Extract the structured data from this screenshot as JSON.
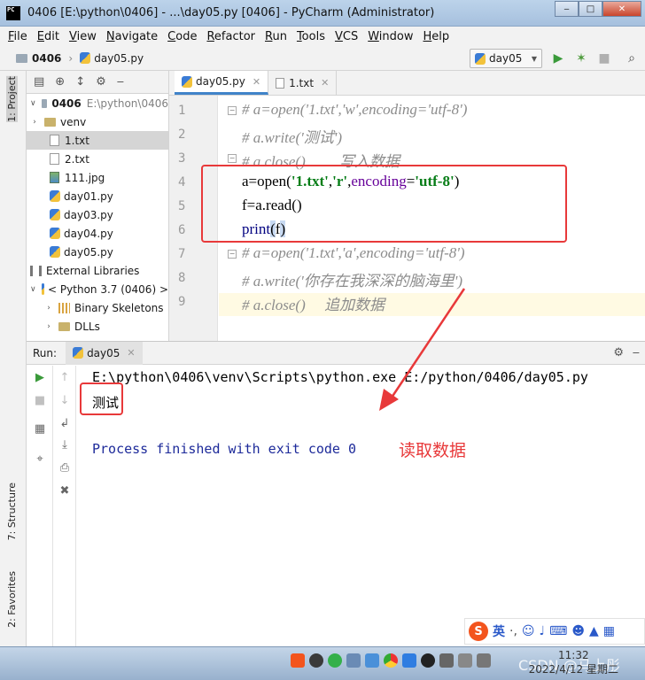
{
  "window": {
    "title": "0406 [E:\\python\\0406] - ...\\day05.py [0406] - PyCharm (Administrator)",
    "app_icon": "PC"
  },
  "menu": [
    "File",
    "Edit",
    "View",
    "Navigate",
    "Code",
    "Refactor",
    "Run",
    "Tools",
    "VCS",
    "Window",
    "Help"
  ],
  "breadcrumb": {
    "project": "0406",
    "file": "day05.py"
  },
  "run_config": {
    "name": "day05"
  },
  "side_tabs": {
    "project": "1: Project",
    "structure": "7: Structure",
    "favorites": "2: Favorites"
  },
  "project_tree": {
    "root_name": "0406",
    "root_path": "E:\\python\\0406",
    "venv": "venv",
    "files": [
      "1.txt",
      "2.txt",
      "111.jpg",
      "day01.py",
      "day03.py",
      "day04.py",
      "day05.py"
    ],
    "external_libraries": "External Libraries",
    "python": "< Python 3.7 (0406) >",
    "binary_skeletons": "Binary Skeletons",
    "dlls": "DLLs"
  },
  "editor_tabs": [
    "day05.py",
    "1.txt"
  ],
  "code_lines": {
    "l1": "# a=open('1.txt','w',encoding='utf-8')",
    "l2": "# a.write('测试')",
    "l3": "# a.close()         写入数据",
    "l4_a": "a=open(",
    "l4_s1": "'1.txt'",
    "l4_c1": ",",
    "l4_s2": "'r'",
    "l4_c2": ",",
    "l4_p": "encoding",
    "l4_eq": "=",
    "l4_s3": "'utf-8'",
    "l4_end": ")",
    "l5": "f=a.read()",
    "l6_fn": "print",
    "l6_open": "(",
    "l6_arg": "f",
    "l6_close": ")",
    "l7": "# a=open('1.txt','a',encoding='utf-8')",
    "l8": "# a.write('你存在我深深的脑海里')",
    "l9": "# a.close()     追加数据"
  },
  "line_numbers": [
    "1",
    "2",
    "3",
    "4",
    "5",
    "6",
    "7",
    "8",
    "9"
  ],
  "run_panel": {
    "label": "Run:",
    "tab": "day05",
    "command": "E:\\python\\0406\\venv\\Scripts\\python.exe E:/python/0406/day05.py",
    "output": "测试",
    "exit": "Process finished with exit code 0"
  },
  "annotation": "读取数据",
  "ime": {
    "logo": "S",
    "lang": "英"
  },
  "clock": {
    "time": "11:32",
    "date": "2022/4/12 星期二"
  },
  "watermark": "CSDN @马上彤",
  "colors": {
    "accent": "#4083c9",
    "highlight_box": "#e8393a",
    "comment": "#8c8c8c",
    "string": "#067d17"
  }
}
